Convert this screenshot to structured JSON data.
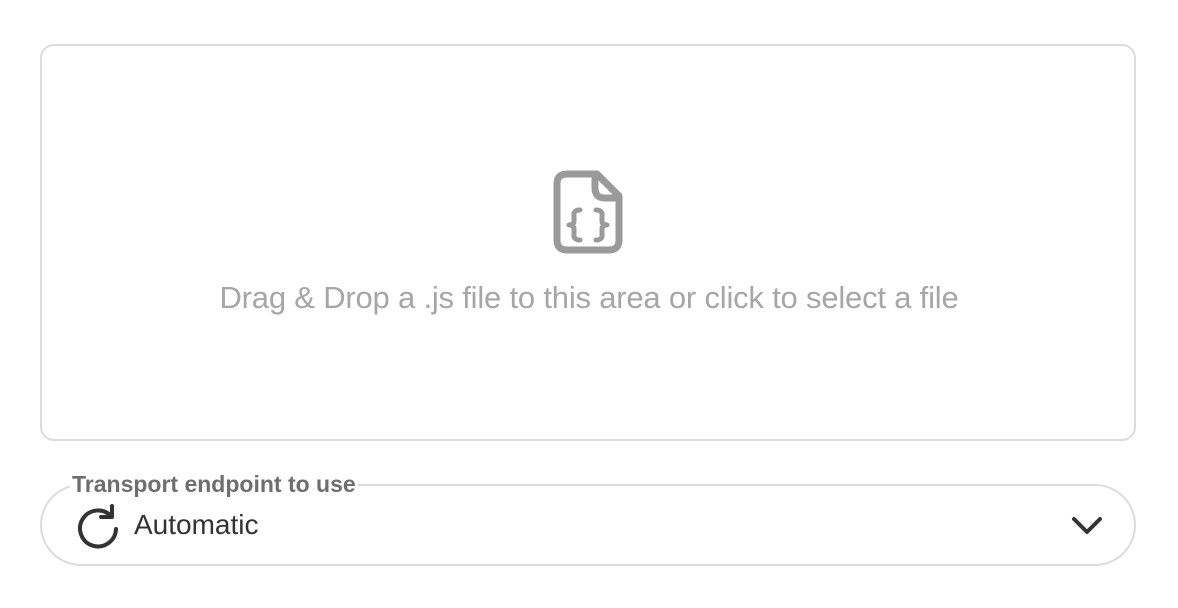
{
  "dropzone": {
    "icon": "file-code-icon",
    "text": "Drag & Drop a .js file to this area or click to select a file"
  },
  "transport": {
    "label": "Transport endpoint to use",
    "selected_icon": "refresh-icon",
    "selected_value": "Automatic",
    "expand_icon": "chevron-down-icon"
  },
  "colors": {
    "border": "#dcdcdc",
    "placeholder_text": "#a6a6a6",
    "icon_gray": "#9a9a9a",
    "label_text": "#6e6e6e",
    "value_text": "#333333"
  }
}
